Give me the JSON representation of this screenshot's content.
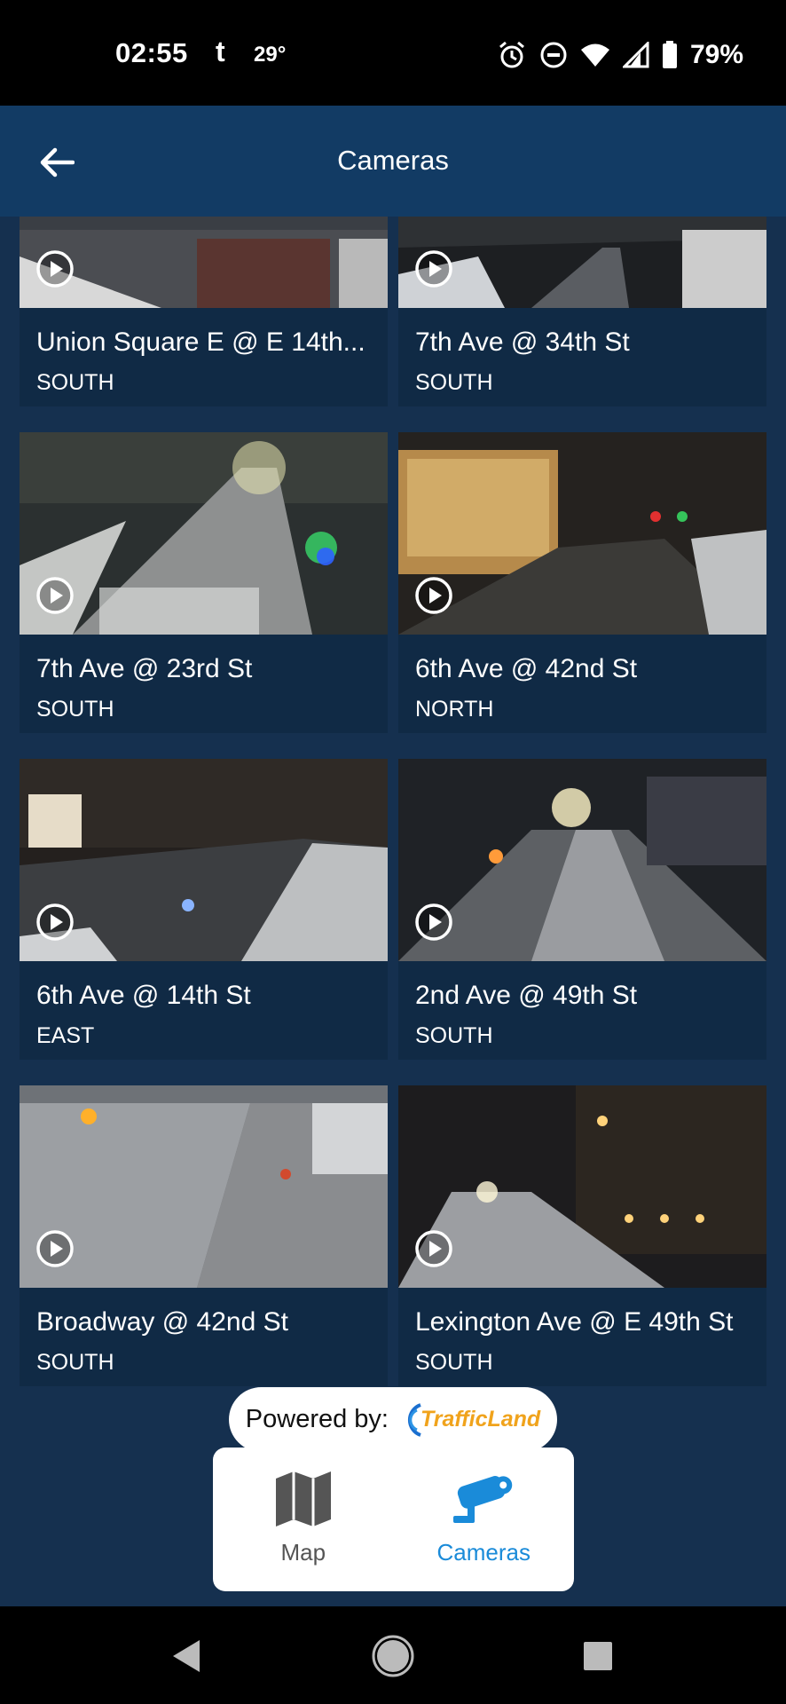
{
  "status_bar": {
    "time": "02:55",
    "app_icon": "t",
    "temperature": "29°",
    "battery": "79%",
    "icons": [
      "alarm-icon",
      "dnd-icon",
      "wifi-icon",
      "signal-icon",
      "battery-icon"
    ]
  },
  "app_bar": {
    "title": "Cameras",
    "back_icon": "arrow-left-icon"
  },
  "cameras": [
    {
      "name": "Union Square E @ E 14th...",
      "direction": "SOUTH"
    },
    {
      "name": "7th Ave @ 34th St",
      "direction": "SOUTH"
    },
    {
      "name": "7th Ave @ 23rd St",
      "direction": "SOUTH"
    },
    {
      "name": "6th Ave @ 42nd St",
      "direction": "NORTH"
    },
    {
      "name": "6th Ave @ 14th St",
      "direction": "EAST"
    },
    {
      "name": "2nd Ave @ 49th St",
      "direction": "SOUTH"
    },
    {
      "name": "Broadway @ 42nd St",
      "direction": "SOUTH"
    },
    {
      "name": "Lexington Ave @ E 49th St",
      "direction": "SOUTH"
    }
  ],
  "footer": {
    "powered_by": "Powered by:",
    "provider_logo": "TrafficLand"
  },
  "bottom_nav": {
    "items": [
      {
        "label": "Map",
        "icon": "map-icon",
        "active": false
      },
      {
        "label": "Cameras",
        "icon": "camera-icon",
        "active": true
      }
    ]
  },
  "colors": {
    "app_bar": "#123b64",
    "background": "#15304f",
    "card": "#102a45",
    "active_tab": "#1a8bd9"
  }
}
